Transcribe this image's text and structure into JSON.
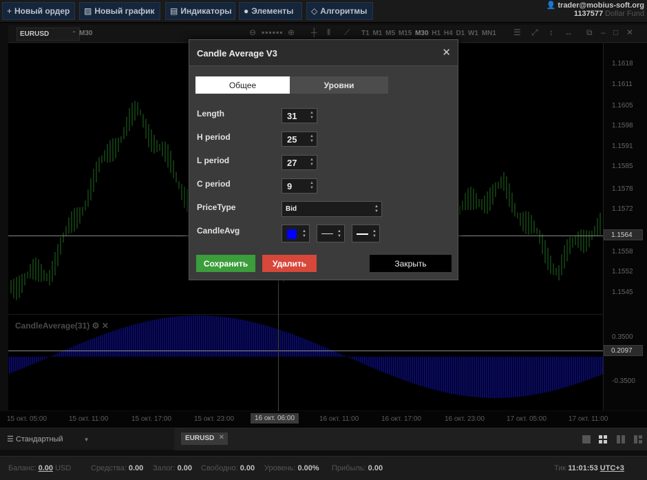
{
  "toolbar": {
    "new_order": "Новый ордер",
    "new_chart": "Новый график",
    "indicators": "Индикаторы",
    "elements": "Элементы",
    "algorithms": "Алгоритмы"
  },
  "account": {
    "user": "trader@mobius-soft.org",
    "number": "1137577",
    "fund": "Dollar Fund"
  },
  "chart_toolbar": {
    "symbol": "EURUSD",
    "timeframe": "M30",
    "timeframes": [
      "T1",
      "M1",
      "M5",
      "M15",
      "M30",
      "H1",
      "H4",
      "D1",
      "W1",
      "MN1"
    ],
    "active_timeframe": "M30"
  },
  "chart": {
    "price_ticks": [
      "1.1618",
      "1.1611",
      "1.1605",
      "1.1598",
      "1.1591",
      "1.1585",
      "1.1578",
      "1.1572",
      "1.1558",
      "1.1552",
      "1.1545"
    ],
    "current_price": "1.1564",
    "indicator_ticks": [
      "0.3500",
      "-0.3500"
    ],
    "indicator_value": "0.2097",
    "indicator_label": "CandleAverage(31)",
    "x_labels": [
      "15 окт. 05:00",
      "15 окт. 11:00",
      "15 окт. 17:00",
      "15 окт. 23:00",
      "16 окт. 06:00",
      "16 окт. 11:00",
      "16 окт. 17:00",
      "16 окт. 23:00",
      "17 окт. 05:00",
      "17 окт. 11:00"
    ],
    "x_highlight": "16 окт. 06:00",
    "colors": {
      "candle": "#1f6e1f",
      "histogram": "#0a0a6e",
      "cursor": "#8c8c8c"
    }
  },
  "bottom_tabs": {
    "workspace": "Стандартный",
    "tab": "EURUSD"
  },
  "status": {
    "balance_label": "Баланс:",
    "balance": "0.00",
    "currency": "USD",
    "funds_label": "Средства:",
    "funds": "0.00",
    "margin_label": "Залог:",
    "margin": "0.00",
    "free_label": "Свободно:",
    "free": "0.00",
    "level_label": "Уровень:",
    "level": "0.00%",
    "profit_label": "Прибыль:",
    "profit": "0.00",
    "tick_label": "Тик",
    "time": "11:01:53",
    "tz": "UTC+3"
  },
  "dialog": {
    "title": "Candle Average V3",
    "tab_general": "Общее",
    "tab_levels": "Уровни",
    "fields": {
      "length_label": "Length",
      "length": "31",
      "h_label": "H period",
      "h": "25",
      "l_label": "L period",
      "l": "27",
      "c_label": "C period",
      "c": "9",
      "price_label": "PriceType",
      "price": "Bid",
      "avg_label": "CandleAvg",
      "avg_color": "#0000ff"
    },
    "save": "Сохранить",
    "delete": "Удалить",
    "close": "Закрыть"
  }
}
